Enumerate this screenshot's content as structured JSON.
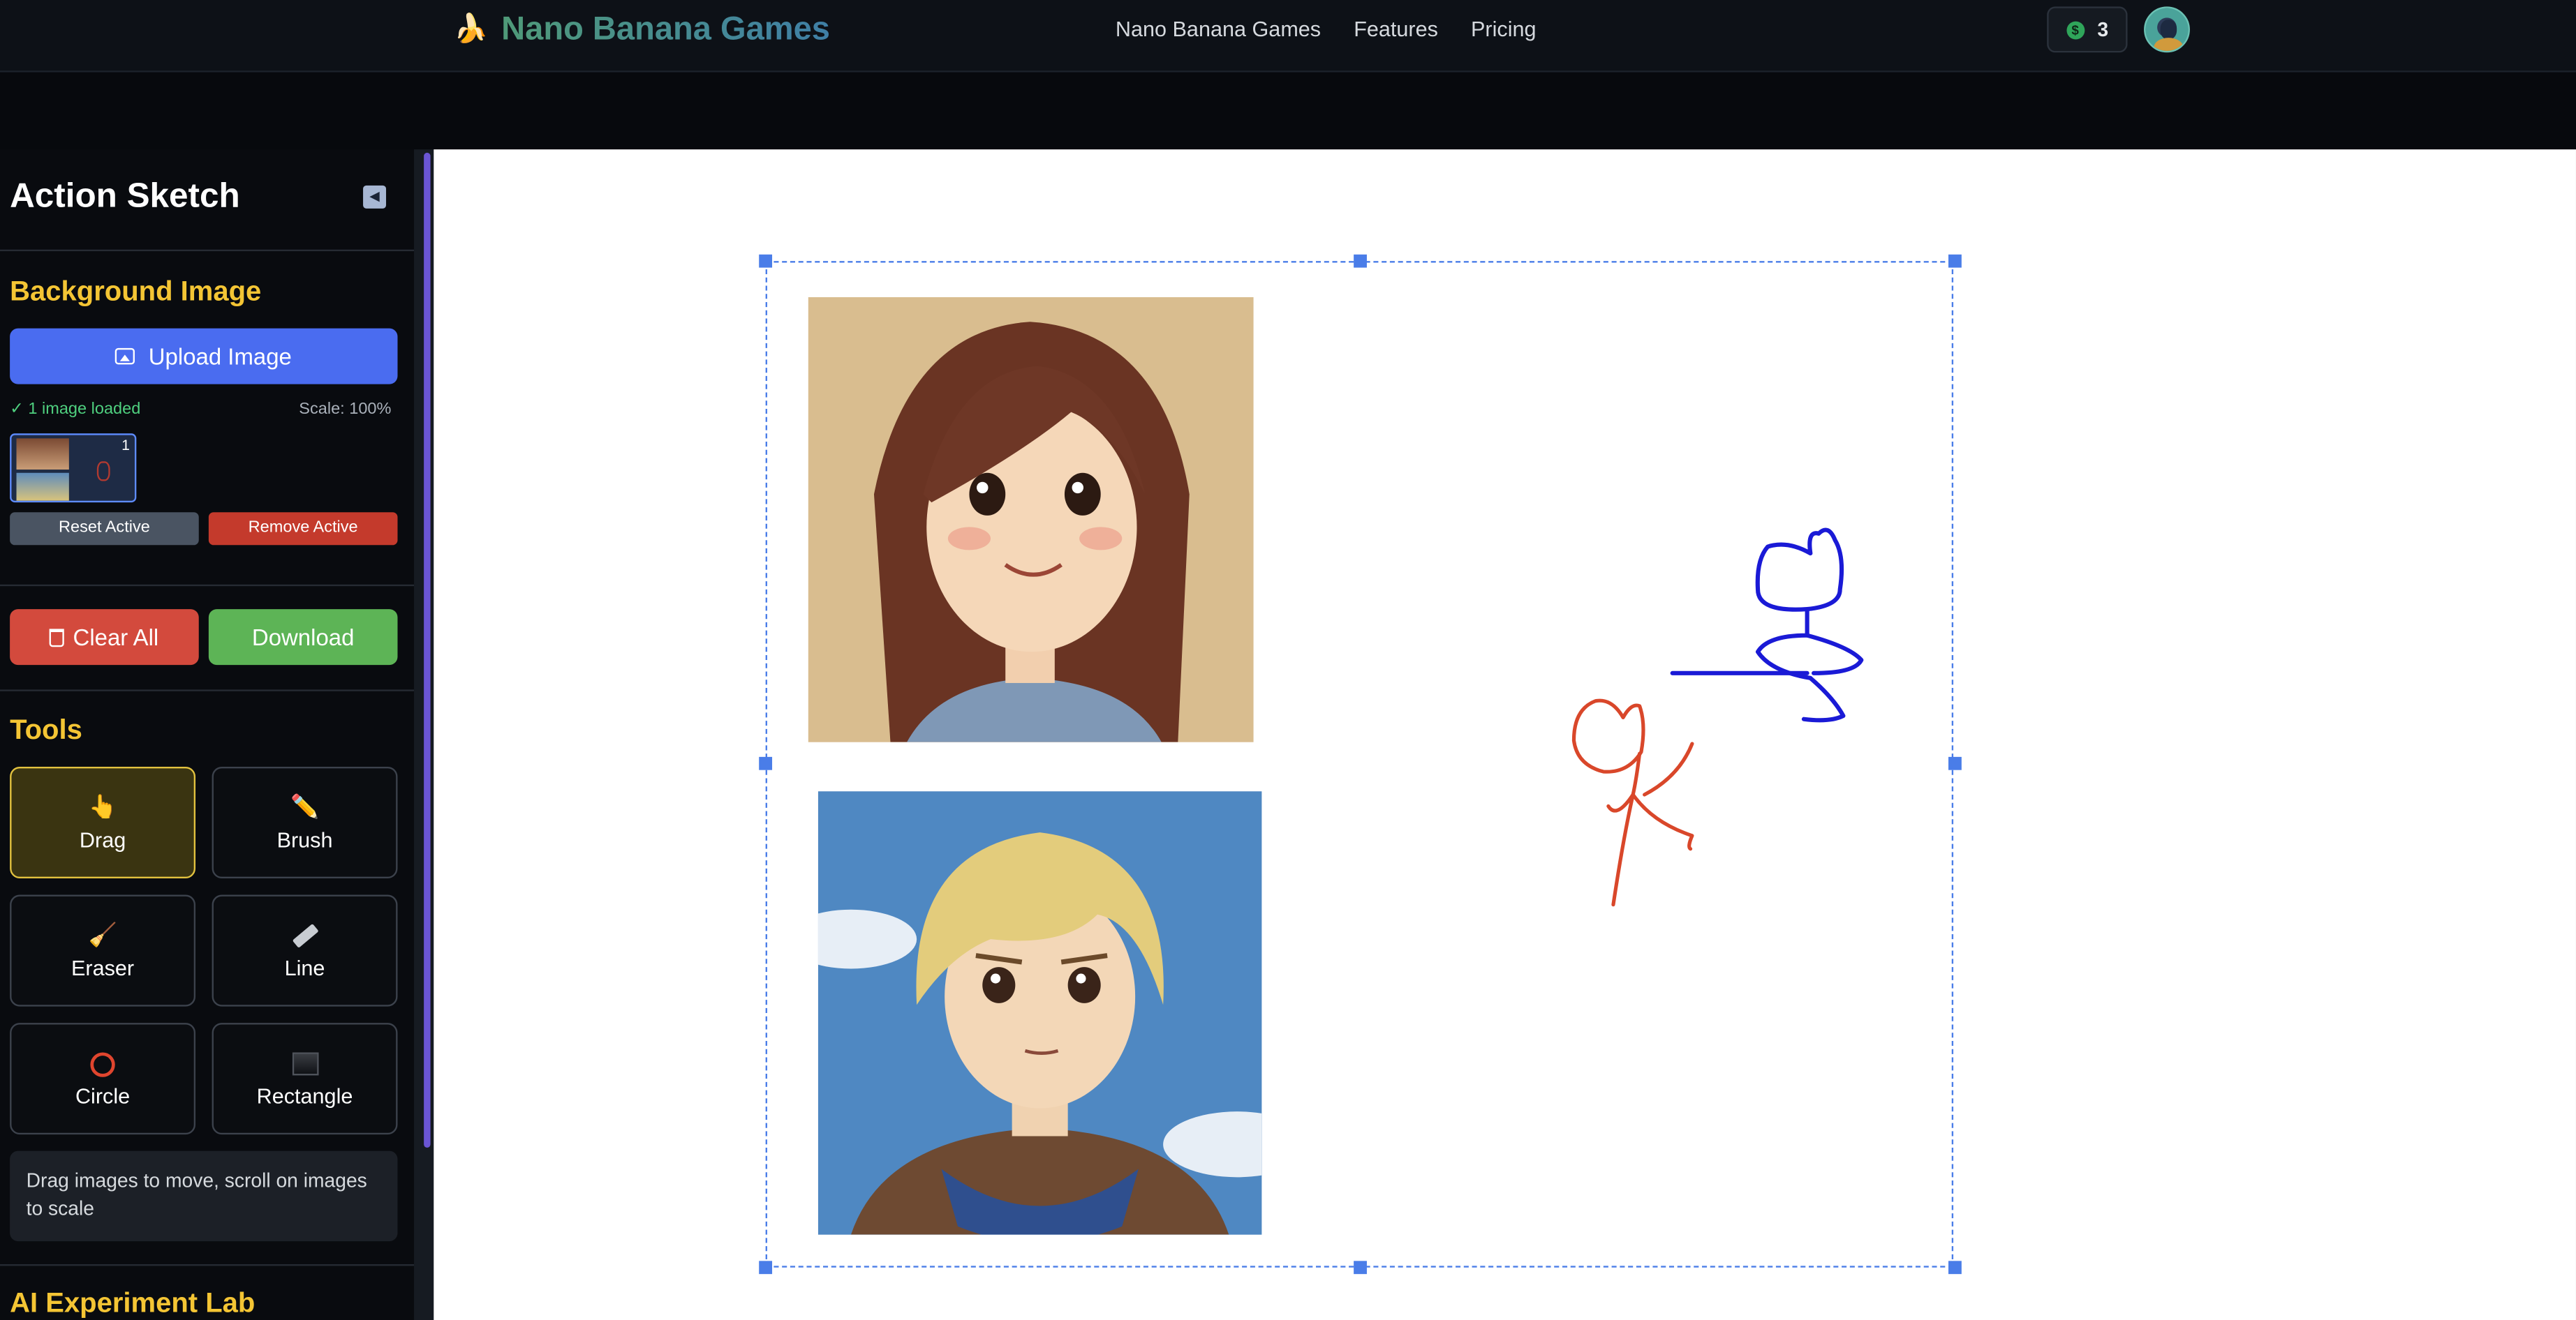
{
  "header": {
    "logo_icon": "banana-icon",
    "brand": "Nano Banana Games",
    "nav": [
      "Nano Banana Games",
      "Features",
      "Pricing"
    ],
    "credits": "3"
  },
  "sidebar": {
    "title": "Action Sketch",
    "background_section": {
      "title": "Background Image",
      "upload_label": "Upload Image",
      "status": "✓ 1 image loaded",
      "scale": "Scale: 100%",
      "thumbnail_index": "1",
      "reset_label": "Reset Active",
      "remove_label": "Remove Active"
    },
    "clear_label": "Clear All",
    "download_label": "Download",
    "tools_title": "Tools",
    "tools": [
      {
        "label": "Drag",
        "icon": "pointing-hand-icon",
        "active": true
      },
      {
        "label": "Brush",
        "icon": "pencil-icon",
        "active": false
      },
      {
        "label": "Eraser",
        "icon": "broom-icon",
        "active": false
      },
      {
        "label": "Line",
        "icon": "ruler-icon",
        "active": false
      },
      {
        "label": "Circle",
        "icon": "circle-icon",
        "active": false
      },
      {
        "label": "Rectangle",
        "icon": "rectangle-icon",
        "active": false
      }
    ],
    "hint": "Drag images to move, scroll on images to scale",
    "lab_title": "AI Experiment Lab"
  },
  "colors": {
    "accent_blue": "#4a6cf0",
    "section_yellow": "#f4c534",
    "danger_red": "#d34a3d",
    "success_green": "#5db456",
    "sketch_blue": "#1a1ad6",
    "sketch_red": "#d9472a"
  }
}
